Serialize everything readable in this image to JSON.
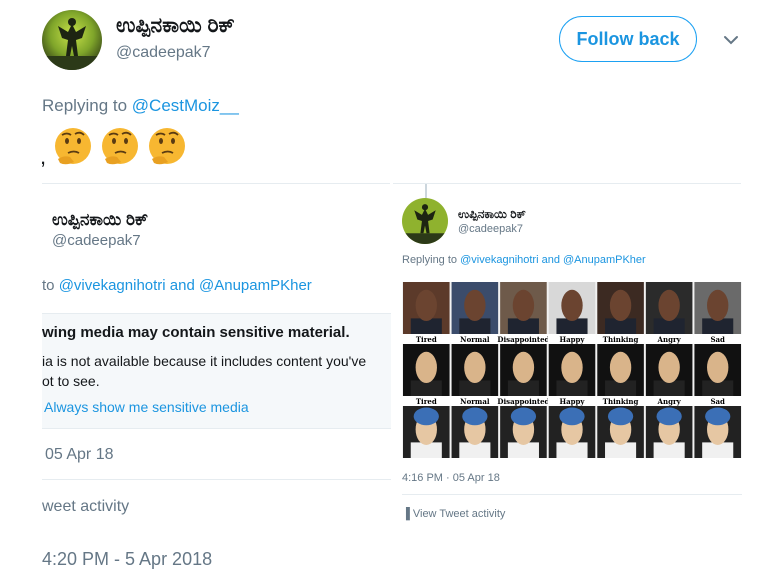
{
  "header": {
    "display_name": "ಉಪ್ಪಿನಕಾಯಿ ರಿಕ್",
    "handle": "@cadeepak7",
    "follow_label": "Follow back",
    "menu_icon": "chevron-down-icon"
  },
  "reply": {
    "prefix": "Replying to",
    "mention": "@CestMoiz__"
  },
  "tweet": {
    "text": ",",
    "emojis": [
      "thinking-face",
      "thinking-face",
      "thinking-face"
    ]
  },
  "left_card": {
    "display_name": "ಉಪ್ಪಿನಕಾಯಿ ರಿಕ್",
    "handle": "@cadeepak7",
    "reply_prefix": "to",
    "reply_mentions": "@vivekagnihotri and @AnupamPKher",
    "sensitive_title": "wing media may contain sensitive material.",
    "sensitive_line1": "ia is not available because it includes content you've",
    "sensitive_line2": "ot to see.",
    "sensitive_link": "Always show me sensitive media",
    "date": "05 Apr 18",
    "activity": "weet activity"
  },
  "right_card": {
    "display_name": "ಉಪ್ಪಿನಕಾಯಿ ರಿಕ್",
    "handle": "@cadeepak7",
    "reply_prefix": "Replying to",
    "reply_mentions": "@vivekagnihotri and @AnupamPKher",
    "grid_labels": [
      "Tired",
      "Normal",
      "Disappointed",
      "Happy",
      "Thinking",
      "Angry",
      "Sad"
    ],
    "date": "4:16 PM · 05 Apr 18",
    "activity": "View Tweet activity"
  },
  "timestamp": "4:20 PM - 5 Apr 2018"
}
